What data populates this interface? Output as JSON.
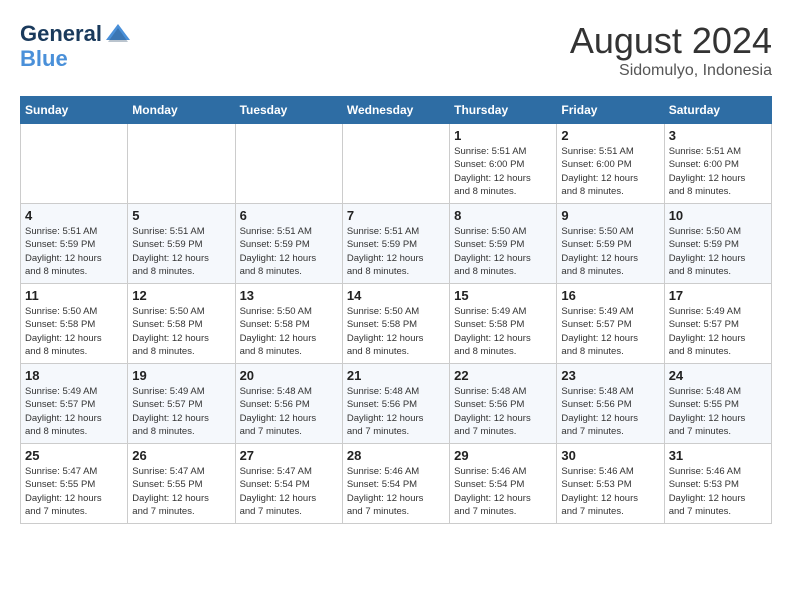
{
  "logo": {
    "text_general": "General",
    "text_blue": "Blue"
  },
  "header": {
    "month_year": "August 2024",
    "location": "Sidomulyo, Indonesia"
  },
  "weekdays": [
    "Sunday",
    "Monday",
    "Tuesday",
    "Wednesday",
    "Thursday",
    "Friday",
    "Saturday"
  ],
  "weeks": [
    [
      {
        "day": "",
        "info": ""
      },
      {
        "day": "",
        "info": ""
      },
      {
        "day": "",
        "info": ""
      },
      {
        "day": "",
        "info": ""
      },
      {
        "day": "1",
        "info": "Sunrise: 5:51 AM\nSunset: 6:00 PM\nDaylight: 12 hours\nand 8 minutes."
      },
      {
        "day": "2",
        "info": "Sunrise: 5:51 AM\nSunset: 6:00 PM\nDaylight: 12 hours\nand 8 minutes."
      },
      {
        "day": "3",
        "info": "Sunrise: 5:51 AM\nSunset: 6:00 PM\nDaylight: 12 hours\nand 8 minutes."
      }
    ],
    [
      {
        "day": "4",
        "info": "Sunrise: 5:51 AM\nSunset: 5:59 PM\nDaylight: 12 hours\nand 8 minutes."
      },
      {
        "day": "5",
        "info": "Sunrise: 5:51 AM\nSunset: 5:59 PM\nDaylight: 12 hours\nand 8 minutes."
      },
      {
        "day": "6",
        "info": "Sunrise: 5:51 AM\nSunset: 5:59 PM\nDaylight: 12 hours\nand 8 minutes."
      },
      {
        "day": "7",
        "info": "Sunrise: 5:51 AM\nSunset: 5:59 PM\nDaylight: 12 hours\nand 8 minutes."
      },
      {
        "day": "8",
        "info": "Sunrise: 5:50 AM\nSunset: 5:59 PM\nDaylight: 12 hours\nand 8 minutes."
      },
      {
        "day": "9",
        "info": "Sunrise: 5:50 AM\nSunset: 5:59 PM\nDaylight: 12 hours\nand 8 minutes."
      },
      {
        "day": "10",
        "info": "Sunrise: 5:50 AM\nSunset: 5:59 PM\nDaylight: 12 hours\nand 8 minutes."
      }
    ],
    [
      {
        "day": "11",
        "info": "Sunrise: 5:50 AM\nSunset: 5:58 PM\nDaylight: 12 hours\nand 8 minutes."
      },
      {
        "day": "12",
        "info": "Sunrise: 5:50 AM\nSunset: 5:58 PM\nDaylight: 12 hours\nand 8 minutes."
      },
      {
        "day": "13",
        "info": "Sunrise: 5:50 AM\nSunset: 5:58 PM\nDaylight: 12 hours\nand 8 minutes."
      },
      {
        "day": "14",
        "info": "Sunrise: 5:50 AM\nSunset: 5:58 PM\nDaylight: 12 hours\nand 8 minutes."
      },
      {
        "day": "15",
        "info": "Sunrise: 5:49 AM\nSunset: 5:58 PM\nDaylight: 12 hours\nand 8 minutes."
      },
      {
        "day": "16",
        "info": "Sunrise: 5:49 AM\nSunset: 5:57 PM\nDaylight: 12 hours\nand 8 minutes."
      },
      {
        "day": "17",
        "info": "Sunrise: 5:49 AM\nSunset: 5:57 PM\nDaylight: 12 hours\nand 8 minutes."
      }
    ],
    [
      {
        "day": "18",
        "info": "Sunrise: 5:49 AM\nSunset: 5:57 PM\nDaylight: 12 hours\nand 8 minutes."
      },
      {
        "day": "19",
        "info": "Sunrise: 5:49 AM\nSunset: 5:57 PM\nDaylight: 12 hours\nand 8 minutes."
      },
      {
        "day": "20",
        "info": "Sunrise: 5:48 AM\nSunset: 5:56 PM\nDaylight: 12 hours\nand 7 minutes."
      },
      {
        "day": "21",
        "info": "Sunrise: 5:48 AM\nSunset: 5:56 PM\nDaylight: 12 hours\nand 7 minutes."
      },
      {
        "day": "22",
        "info": "Sunrise: 5:48 AM\nSunset: 5:56 PM\nDaylight: 12 hours\nand 7 minutes."
      },
      {
        "day": "23",
        "info": "Sunrise: 5:48 AM\nSunset: 5:56 PM\nDaylight: 12 hours\nand 7 minutes."
      },
      {
        "day": "24",
        "info": "Sunrise: 5:48 AM\nSunset: 5:55 PM\nDaylight: 12 hours\nand 7 minutes."
      }
    ],
    [
      {
        "day": "25",
        "info": "Sunrise: 5:47 AM\nSunset: 5:55 PM\nDaylight: 12 hours\nand 7 minutes."
      },
      {
        "day": "26",
        "info": "Sunrise: 5:47 AM\nSunset: 5:55 PM\nDaylight: 12 hours\nand 7 minutes."
      },
      {
        "day": "27",
        "info": "Sunrise: 5:47 AM\nSunset: 5:54 PM\nDaylight: 12 hours\nand 7 minutes."
      },
      {
        "day": "28",
        "info": "Sunrise: 5:46 AM\nSunset: 5:54 PM\nDaylight: 12 hours\nand 7 minutes."
      },
      {
        "day": "29",
        "info": "Sunrise: 5:46 AM\nSunset: 5:54 PM\nDaylight: 12 hours\nand 7 minutes."
      },
      {
        "day": "30",
        "info": "Sunrise: 5:46 AM\nSunset: 5:53 PM\nDaylight: 12 hours\nand 7 minutes."
      },
      {
        "day": "31",
        "info": "Sunrise: 5:46 AM\nSunset: 5:53 PM\nDaylight: 12 hours\nand 7 minutes."
      }
    ]
  ]
}
